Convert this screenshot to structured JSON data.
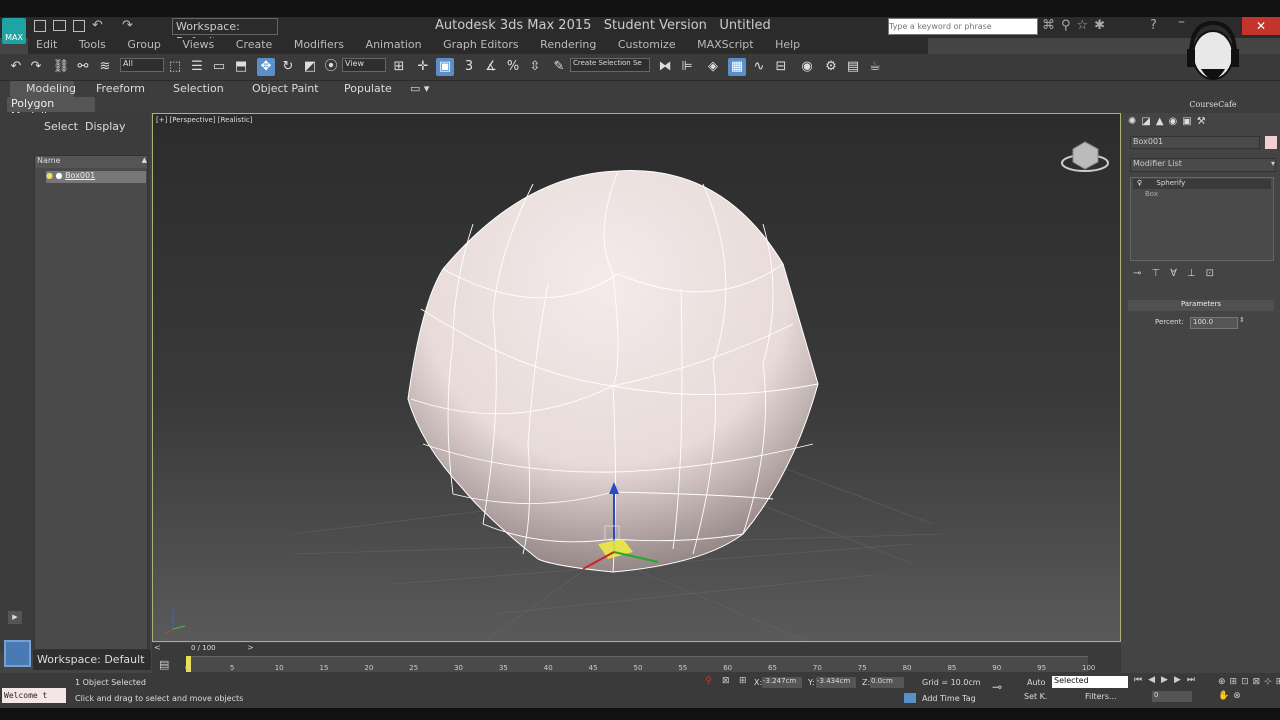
{
  "title": {
    "app": "Autodesk 3ds Max 2015",
    "edition": "Student Version",
    "doc": "Untitled",
    "workspace": "Workspace: Default",
    "search_placeholder": "Type a keyword or phrase"
  },
  "menu": [
    "Edit",
    "Tools",
    "Group",
    "Views",
    "Create",
    "Modifiers",
    "Animation",
    "Graph Editors",
    "Rendering",
    "Customize",
    "MAXScript",
    "Help"
  ],
  "toolbar": {
    "filter": "All",
    "view": "View",
    "selset": "Create Selection Se",
    "snap": "3"
  },
  "ribbon": {
    "tabs": [
      "Modeling",
      "Freeform",
      "Selection",
      "Object Paint",
      "Populate"
    ],
    "sub": "Polygon Modeling"
  },
  "scene": {
    "tabs": [
      "Select",
      "Display"
    ],
    "col": "Name",
    "item": "Box001"
  },
  "viewport": {
    "label": "[+] [Perspective] [Realistic]"
  },
  "cmd": {
    "name": "Box001",
    "modlist": "Modifier List",
    "stack": [
      "Spherify",
      "Box"
    ],
    "rollout": "Parameters",
    "percent_label": "Percent:",
    "percent": "100.0"
  },
  "track": {
    "frame": "0 / 100",
    "ticks": [
      "0",
      "5",
      "10",
      "15",
      "20",
      "25",
      "30",
      "35",
      "40",
      "45",
      "50",
      "55",
      "60",
      "65",
      "70",
      "75",
      "80",
      "85",
      "90",
      "95",
      "100"
    ]
  },
  "status": {
    "welcome": "Welcome t",
    "workspace": "Workspace: Default",
    "selected": "1 Object Selected",
    "hint": "Click and drag to select and move objects",
    "x": "-3.247cm",
    "y": "-3.434cm",
    "z": "0.0cm",
    "grid": "Grid = 10.0cm",
    "auto": "Auto",
    "setk": "Set K.",
    "keymode": "Selected",
    "filters": "Filters...",
    "timetag": "Add Time Tag",
    "frame": "0"
  },
  "logo": "CourseCafe"
}
